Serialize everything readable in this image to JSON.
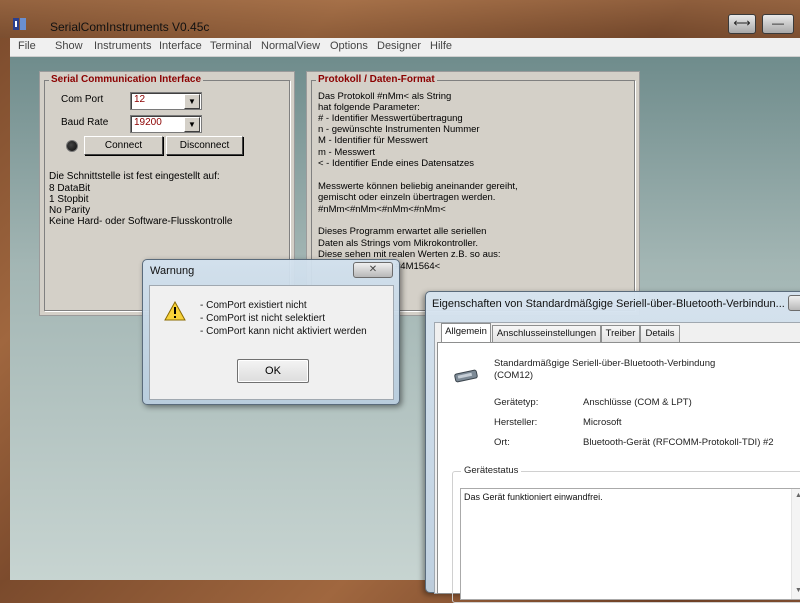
{
  "app": {
    "title": "SerialComInstruments  V0.45c",
    "restore_glyph": "⟷",
    "minimize_glyph": "—"
  },
  "menu": [
    "File",
    "Show",
    "Instruments",
    "Interface",
    "Terminal",
    "NormalView",
    "Options",
    "Designer",
    "Hilfe"
  ],
  "serial": {
    "group_title": "Serial Communication Interface",
    "com_port_label": "Com Port",
    "com_port_value": "12",
    "baud_rate_label": "Baud Rate",
    "baud_rate_value": "19200",
    "connect_label": "Connect",
    "disconnect_label": "Disconnect",
    "info_lines": [
      "Die Schnittstelle ist fest eingestellt auf:",
      "8 DataBit",
      "1 Stopbit",
      "No Parity",
      "Keine Hard- oder Software-Flusskontrolle"
    ]
  },
  "protocol": {
    "group_title": "Protokoll / Daten-Format",
    "lines": [
      "Das Protokoll      #nMm<     als String",
      "hat folgende Parameter:",
      "#  -  Identifier Messwertübertragung",
      "n  -  gewünschte Instrumenten Nummer",
      "M  -  Identifier für Messwert",
      "m  -  Messwert",
      "<  -  Identifier Ende eines Datensatzes",
      "",
      "Messwerte können beliebig aneinander gereiht,",
      "gemischt oder einzeln übertragen werden.",
      "#nMm<#nMm<#nMm<#nMm<",
      "",
      "Dieses Programm erwartet alle seriellen",
      "Daten als Strings vom Mikrokontroller.",
      "Diese sehen mit realen Werten z.B. so aus:",
      "#4M1564<"
    ]
  },
  "warning_dialog": {
    "title": "Warnung",
    "close_glyph": "✕",
    "icon": "warning-triangle-icon",
    "messages": [
      "-  ComPort existiert nicht",
      "-  ComPort ist nicht selektiert",
      "-  ComPort kann nicht aktiviert werden"
    ],
    "ok_label": "OK"
  },
  "properties_dialog": {
    "title": "Eigenschaften von Standardmäßgige Seriell-über-Bluetooth-Verbindun...",
    "close_glyph": "✕",
    "tabs": [
      "Allgemein",
      "Anschlusseinstellungen",
      "Treiber",
      "Details"
    ],
    "device_name": "Standardmäßgige Seriell-über-Bluetooth-Verbindung",
    "device_port": "(COM12)",
    "fields": [
      {
        "label": "Gerätetyp:",
        "value": "Anschlüsse (COM & LPT)"
      },
      {
        "label": "Hersteller:",
        "value": "Microsoft"
      },
      {
        "label": "Ort:",
        "value": "Bluetooth-Gerät (RFCOMM-Protokoll-TDI) #2"
      }
    ],
    "status_legend": "Gerätestatus",
    "status_text": "Das Gerät funktioniert einwandfrei."
  }
}
